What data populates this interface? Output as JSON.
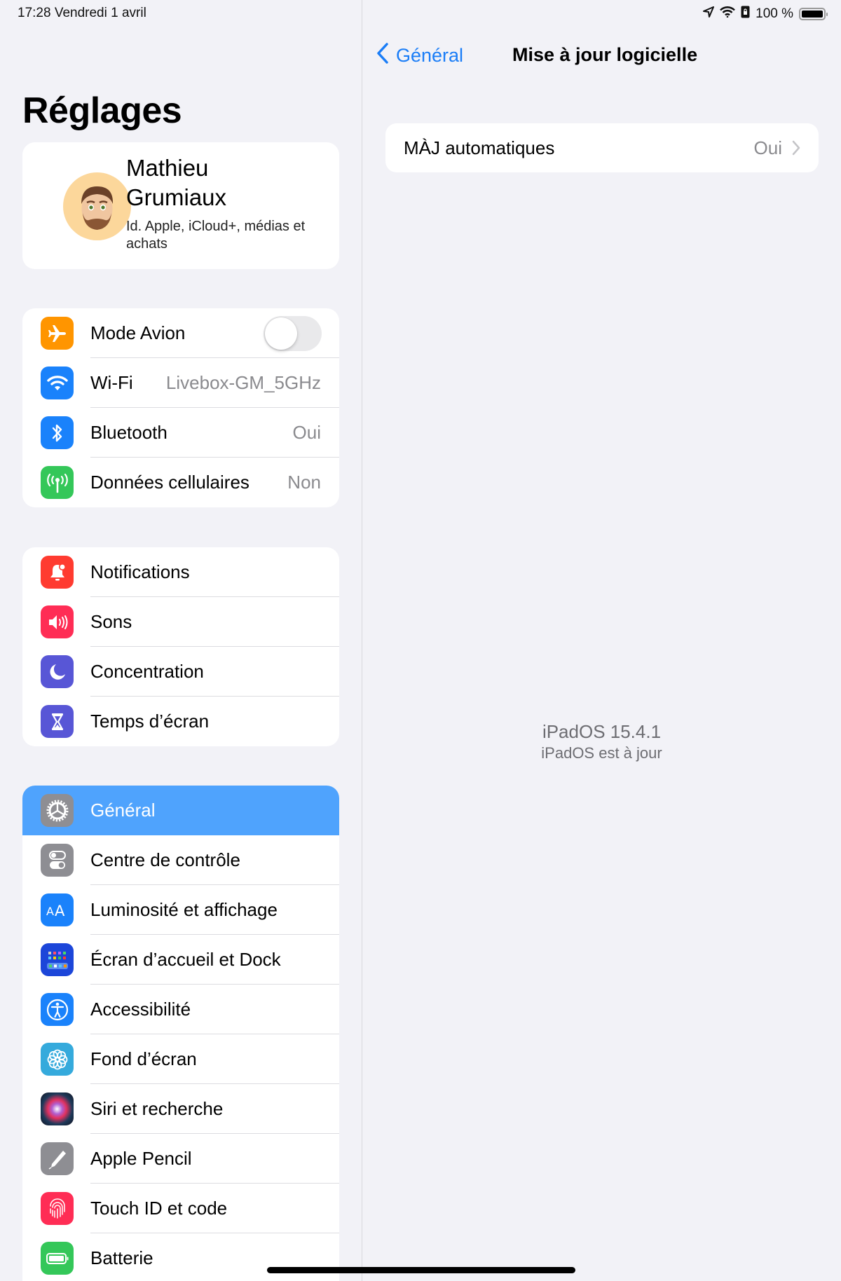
{
  "status_bar": {
    "time_date": "17:28   Vendredi 1 avril",
    "battery_percent": "100 %",
    "battery_level": 1.0,
    "icons": [
      "location-arrow-icon",
      "wifi-icon",
      "orientation-lock-icon",
      "battery-icon"
    ]
  },
  "sidebar": {
    "title": "Réglages",
    "profile": {
      "name": "Mathieu Grumiaux",
      "subtitle": "Id. Apple, iCloud+, médias et achats"
    },
    "groups": [
      {
        "items": [
          {
            "label": "Mode Avion",
            "icon": "airplane-icon",
            "color": "#ff9500",
            "toggle": false
          },
          {
            "label": "Wi-Fi",
            "icon": "wifi-icon",
            "color": "#1a82fb",
            "value": "Livebox-GM_5GHz"
          },
          {
            "label": "Bluetooth",
            "icon": "bluetooth-icon",
            "color": "#1a82fb",
            "value": "Oui"
          },
          {
            "label": "Données cellulaires",
            "icon": "antenna-icon",
            "color": "#34c759",
            "value": "Non"
          }
        ]
      },
      {
        "items": [
          {
            "label": "Notifications",
            "icon": "notification-bell-icon",
            "color": "#ff3b30"
          },
          {
            "label": "Sons",
            "icon": "speaker-icon",
            "color": "#ff2d55"
          },
          {
            "label": "Concentration",
            "icon": "moon-icon",
            "color": "#5856d6"
          },
          {
            "label": "Temps d’écran",
            "icon": "hourglass-icon",
            "color": "#5856d6"
          }
        ]
      },
      {
        "items": [
          {
            "label": "Général",
            "icon": "gear-icon",
            "color": "#8e8e93",
            "selected": true
          },
          {
            "label": "Centre de contrôle",
            "icon": "switches-icon",
            "color": "#8e8e93"
          },
          {
            "label": "Luminosité et affichage",
            "icon": "text-size-icon",
            "color": "#1a82fb"
          },
          {
            "label": "Écran d’accueil et Dock",
            "icon": "home-screen-grid-icon",
            "color": "#1c46d9"
          },
          {
            "label": "Accessibilité",
            "icon": "accessibility-icon",
            "color": "#1a82fb"
          },
          {
            "label": "Fond d’écran",
            "icon": "flower-icon",
            "color": "#35aadc"
          },
          {
            "label": "Siri et recherche",
            "icon": "siri-icon",
            "color": "#1b1b2e"
          },
          {
            "label": "Apple Pencil",
            "icon": "pencil-icon",
            "color": "#8e8e93"
          },
          {
            "label": "Touch ID et code",
            "icon": "fingerprint-icon",
            "color": "#ff2d55"
          },
          {
            "label": "Batterie",
            "icon": "battery-icon",
            "color": "#34c759"
          }
        ]
      }
    ]
  },
  "detail": {
    "back_label": "Général",
    "title": "Mise à jour logicielle",
    "auto_update": {
      "label": "MÀJ automatiques",
      "value": "Oui"
    },
    "os_version": "iPadOS 15.4.1",
    "os_status": "iPadOS est à jour"
  },
  "colors": {
    "accent": "#1a7df7",
    "selected_row": "#4fa3fd",
    "background": "#f2f2f7"
  }
}
